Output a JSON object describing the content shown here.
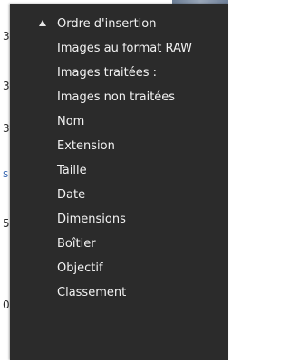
{
  "background": {
    "edge_chars": [
      {
        "text": "3",
        "blue": false
      },
      {
        "text": "3",
        "blue": false
      },
      {
        "text": "3",
        "blue": false
      },
      {
        "text": "s",
        "blue": true
      },
      {
        "text": "5",
        "blue": false
      },
      {
        "text": "0",
        "blue": false
      }
    ]
  },
  "menu": {
    "items": [
      {
        "label": "Ordre d'insertion",
        "selected": true,
        "sort_icon": "triangle-up-icon"
      },
      {
        "label": "Images au format RAW"
      },
      {
        "label": "Images traitées :"
      },
      {
        "label": "Images non traitées"
      },
      {
        "label": "Nom"
      },
      {
        "label": "Extension"
      },
      {
        "label": "Taille"
      },
      {
        "label": "Date"
      },
      {
        "label": "Dimensions"
      },
      {
        "label": "Boîtier"
      },
      {
        "label": "Objectif"
      },
      {
        "label": "Classement"
      }
    ]
  },
  "colors": {
    "menu_background": "#2b2b2b",
    "menu_text": "#f2f2f2",
    "edge_link_blue": "#3d6bb3"
  }
}
